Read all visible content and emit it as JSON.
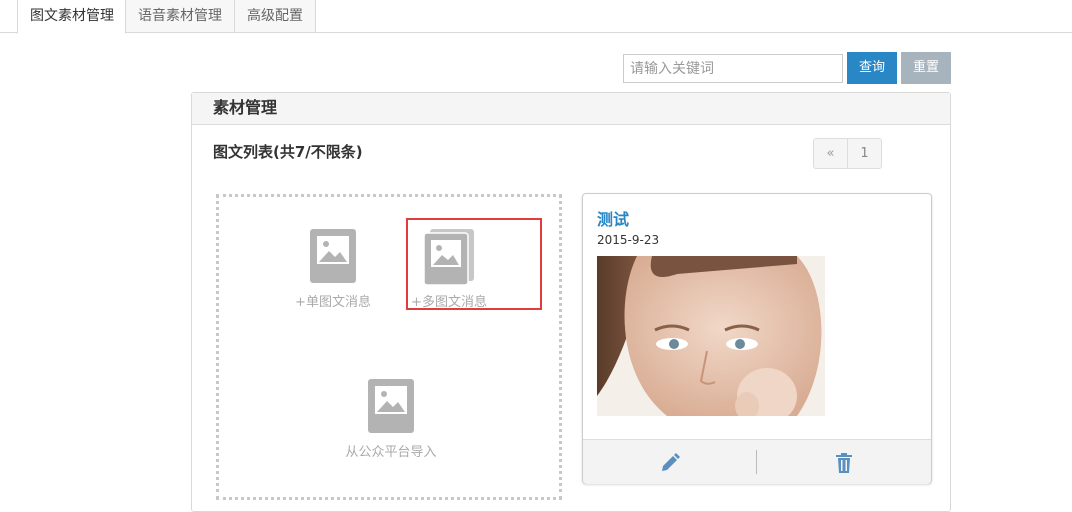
{
  "tabs": [
    {
      "label": "图文素材管理"
    },
    {
      "label": "语音素材管理"
    },
    {
      "label": "高级配置"
    }
  ],
  "search": {
    "placeholder": "请输入关键词",
    "value": "",
    "query_label": "查询",
    "reset_label": "重置"
  },
  "panel": {
    "title": "素材管理",
    "list_title": "图文列表(共7/不限条)"
  },
  "pager": {
    "prev": "«",
    "current": "1"
  },
  "add_area": {
    "single_label": "+单图文消息",
    "multi_label": "+多图文消息",
    "import_label": "从公众平台导入",
    "icon": "image-placeholder-icon"
  },
  "card": {
    "title": "测试",
    "date": "2015-9-23",
    "edit_icon": "pencil-icon",
    "delete_icon": "trash-icon"
  },
  "colors": {
    "accent": "#2a87c6",
    "reset_button": "#a7b3bd",
    "highlight": "#e03c3c"
  }
}
